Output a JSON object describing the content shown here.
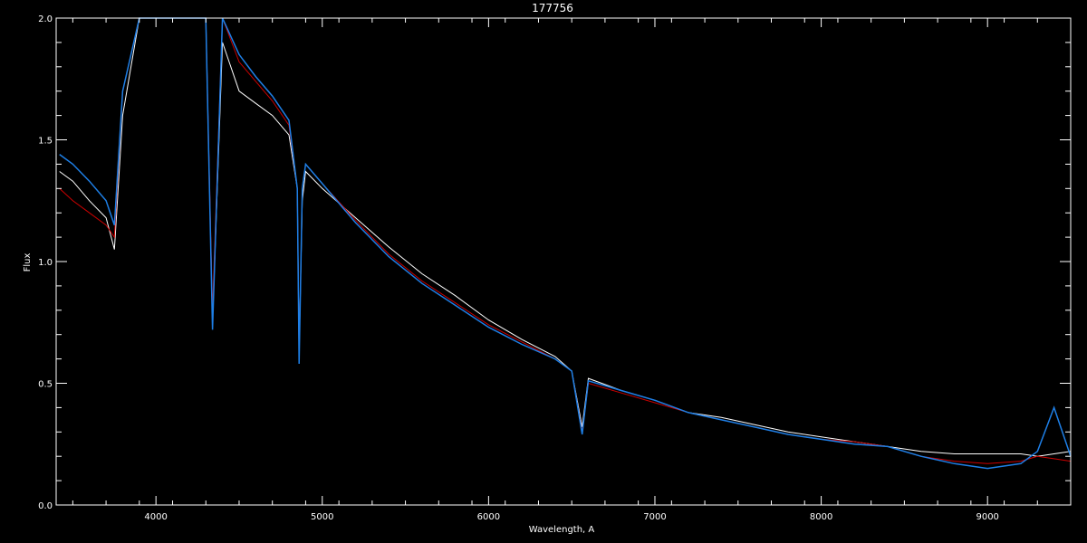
{
  "chart_data": {
    "type": "line",
    "title": "177756",
    "xlabel": "Wavelength, A",
    "ylabel": "Flux",
    "xlim": [
      3400,
      9500
    ],
    "ylim": [
      0.0,
      2.0
    ],
    "x_ticks": [
      4000,
      5000,
      6000,
      7000,
      8000,
      9000
    ],
    "x_tick_labels": [
      "4000",
      "5000",
      "6000",
      "7000",
      "8000",
      "9000"
    ],
    "y_ticks": [
      0.0,
      0.5,
      1.0,
      1.5,
      2.0
    ],
    "y_tick_labels": [
      "0.0",
      "0.5",
      "1.0",
      "1.5",
      "2.0"
    ],
    "grid": false,
    "colors": {
      "background": "#000000",
      "axes": "#ffffff",
      "observed": "#ffffff",
      "model": "#cc0000",
      "calibrated": "#1e7fe6"
    },
    "series": [
      {
        "color": "#ffffff",
        "x": [
          3420,
          3500,
          3600,
          3700,
          3750,
          3800,
          3900,
          4000,
          4100,
          4200,
          4300,
          4340,
          4400,
          4500,
          4600,
          4700,
          4800,
          4850,
          4861,
          4880,
          4900,
          5000,
          5200,
          5400,
          5600,
          5800,
          6000,
          6200,
          6400,
          6500,
          6563,
          6600,
          6800,
          7000,
          7200,
          7400,
          7600,
          7800,
          8000,
          8200,
          8400,
          8600,
          8800,
          9000,
          9200,
          9300,
          9400,
          9500
        ],
        "y": [
          1.37,
          1.33,
          1.25,
          1.18,
          1.05,
          1.6,
          2.0,
          2.0,
          2.0,
          2.0,
          2.0,
          0.75,
          1.9,
          1.7,
          1.65,
          1.6,
          1.52,
          1.3,
          0.62,
          1.25,
          1.37,
          1.3,
          1.18,
          1.06,
          0.95,
          0.86,
          0.76,
          0.68,
          0.61,
          0.55,
          0.32,
          0.52,
          0.47,
          0.43,
          0.38,
          0.36,
          0.33,
          0.3,
          0.28,
          0.26,
          0.24,
          0.22,
          0.21,
          0.21,
          0.21,
          0.2,
          0.21,
          0.22
        ]
      },
      {
        "color": "#cc0000",
        "x": [
          3420,
          3500,
          3600,
          3700,
          3750,
          3800,
          3900,
          4000,
          4100,
          4200,
          4300,
          4340,
          4400,
          4500,
          4600,
          4700,
          4800,
          4850,
          4861,
          4880,
          4900,
          5000,
          5200,
          5400,
          5600,
          5800,
          6000,
          6200,
          6400,
          6500,
          6563,
          6600,
          6800,
          7000,
          7200,
          7400,
          7600,
          7800,
          8000,
          8200,
          8400,
          8600,
          8800,
          9000,
          9200,
          9300,
          9400,
          9500
        ],
        "y": [
          1.3,
          1.25,
          1.2,
          1.15,
          1.1,
          1.7,
          2.0,
          2.0,
          2.0,
          2.0,
          2.0,
          0.8,
          2.0,
          1.82,
          1.74,
          1.66,
          1.56,
          1.3,
          0.6,
          1.3,
          1.4,
          1.32,
          1.17,
          1.03,
          0.92,
          0.83,
          0.74,
          0.67,
          0.6,
          0.55,
          0.3,
          0.5,
          0.46,
          0.42,
          0.38,
          0.35,
          0.32,
          0.29,
          0.27,
          0.26,
          0.24,
          0.2,
          0.18,
          0.17,
          0.18,
          0.2,
          0.19,
          0.18
        ]
      },
      {
        "color": "#1e7fe6",
        "x": [
          3420,
          3500,
          3600,
          3700,
          3750,
          3800,
          3900,
          4000,
          4100,
          4200,
          4300,
          4340,
          4400,
          4500,
          4600,
          4700,
          4800,
          4850,
          4861,
          4880,
          4900,
          5000,
          5200,
          5400,
          5600,
          5800,
          6000,
          6200,
          6400,
          6500,
          6563,
          6600,
          6800,
          7000,
          7200,
          7400,
          7600,
          7800,
          8000,
          8200,
          8400,
          8600,
          8800,
          9000,
          9200,
          9300,
          9400,
          9500
        ],
        "y": [
          1.44,
          1.4,
          1.33,
          1.25,
          1.15,
          1.7,
          2.0,
          2.0,
          2.0,
          2.0,
          2.0,
          0.72,
          2.0,
          1.85,
          1.76,
          1.68,
          1.58,
          1.3,
          0.58,
          1.3,
          1.4,
          1.32,
          1.16,
          1.02,
          0.91,
          0.82,
          0.73,
          0.66,
          0.6,
          0.55,
          0.29,
          0.51,
          0.47,
          0.43,
          0.38,
          0.35,
          0.32,
          0.29,
          0.27,
          0.25,
          0.24,
          0.2,
          0.17,
          0.15,
          0.17,
          0.22,
          0.4,
          0.2
        ]
      }
    ]
  }
}
